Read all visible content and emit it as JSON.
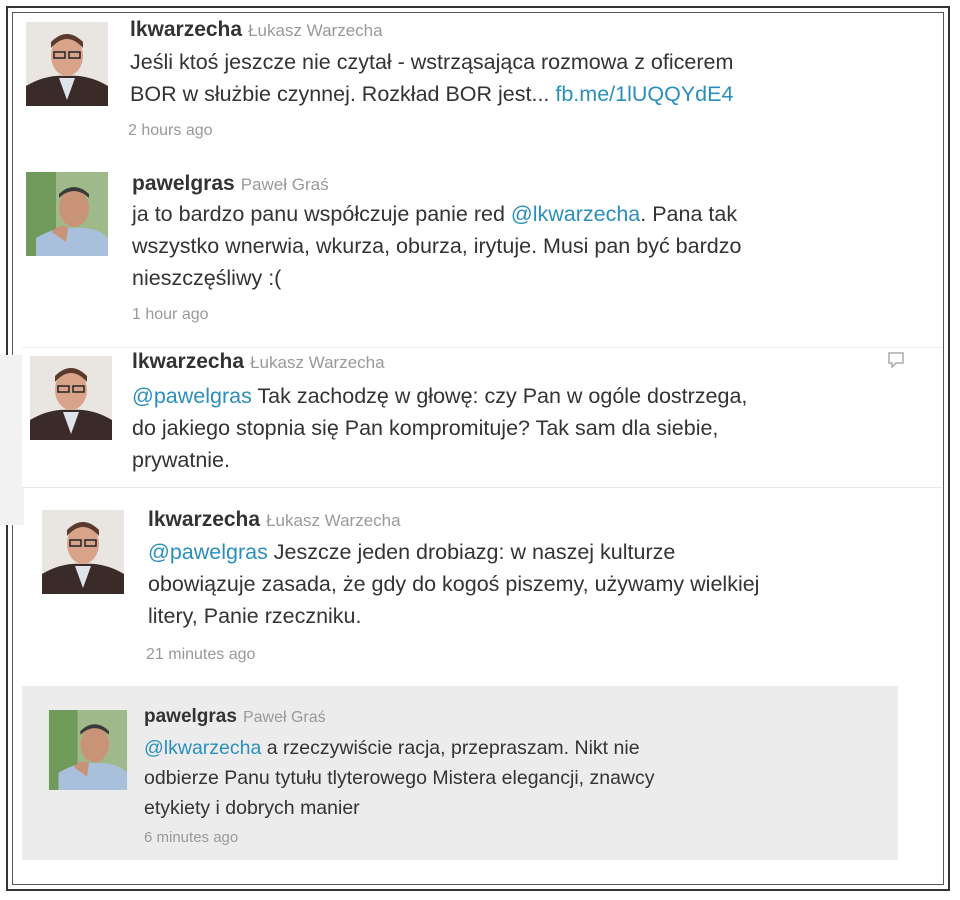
{
  "tweets": [
    {
      "screen_name": "lkwarzecha",
      "real_name": "Łukasz Warzecha",
      "lines": [
        "Jeśli ktoś jeszcze nie czytał - wstrząsająca rozmowa z oficerem"
      ],
      "line2_text": "BOR w służbie czynnej. Rozkład BOR jest... ",
      "link": "fb.me/1lUQQYdE4",
      "time": "2 hours ago"
    },
    {
      "screen_name": "pawelgras",
      "real_name": "Paweł Graś",
      "line1_text": "ja to bardzo panu współczuje panie red ",
      "mention": "@lkwarzecha",
      "line1_tail": ". Pana tak",
      "line2": "wszystko wnerwia, wkurza, oburza, irytuje. Musi pan być bardzo",
      "line3": "nieszczęśliwy :(",
      "time": "1 hour ago"
    },
    {
      "screen_name": "lkwarzecha",
      "real_name": "Łukasz Warzecha",
      "mention": "@pawelgras",
      "line1_tail": " Tak zachodzę w głowę: czy Pan w ogóle dostrzega,",
      "line2": "do jakiego stopnia się Pan kompromituje? Tak sam dla siebie,",
      "line3": "prywatnie.",
      "reply_icon": "reply-icon"
    },
    {
      "screen_name": "lkwarzecha",
      "real_name": "Łukasz Warzecha",
      "mention": "@pawelgras",
      "line1_tail": " Jeszcze jeden drobiazg: w naszej kulturze",
      "line2": "obowiązuje zasada, że gdy do kogoś piszemy, używamy wielkiej",
      "line3": "litery, Panie rzeczniku.",
      "time": "21 minutes ago"
    },
    {
      "screen_name": "pawelgras",
      "real_name": "Paweł Graś",
      "mention": "@lkwarzecha",
      "line1_tail": " a rzeczywiście racja, przepraszam. Nikt nie",
      "line2": "odbierze Panu tytułu tlyterowego Mistera elegancji, znawcy",
      "line3": "etykiety i dobrych manier",
      "time": "6 minutes ago"
    }
  ],
  "colors": {
    "link": "#2a8fbd",
    "text": "#333333",
    "meta": "#999999",
    "highlight_bg": "#ececec"
  }
}
